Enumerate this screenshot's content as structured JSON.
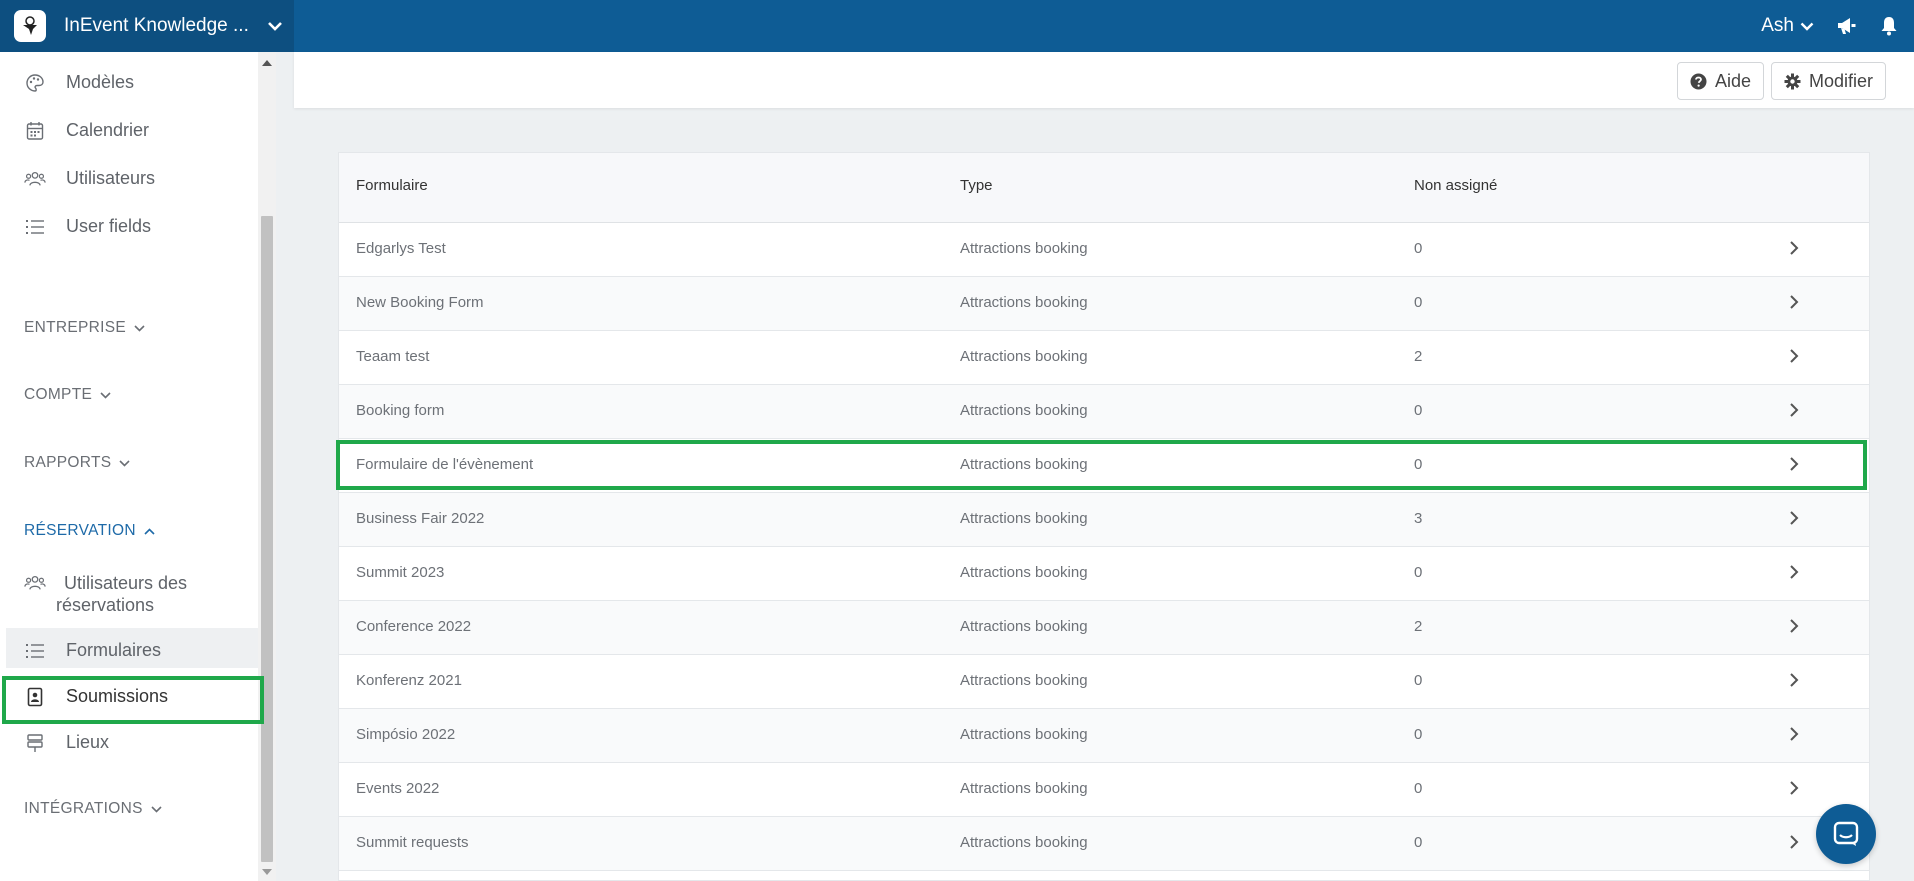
{
  "topbar": {
    "title": "InEvent Knowledge ...",
    "user": "Ash"
  },
  "sidebar": {
    "items": [
      {
        "label": "Modèles",
        "icon": "palette-icon"
      },
      {
        "label": "Calendrier",
        "icon": "calendar-icon"
      },
      {
        "label": "Utilisateurs",
        "icon": "users-icon"
      },
      {
        "label": "User fields",
        "icon": "list-icon"
      }
    ],
    "sections": [
      {
        "label": "ENTREPRISE"
      },
      {
        "label": "COMPTE"
      },
      {
        "label": "RAPPORTS"
      },
      {
        "label": "RÉSERVATION"
      },
      {
        "label": "INTÉGRATIONS"
      }
    ],
    "reservation_items": [
      {
        "label_line1": "Utilisateurs des",
        "label_line2": "réservations",
        "icon": "users-icon"
      },
      {
        "label": "Formulaires",
        "icon": "list-icon"
      },
      {
        "label": "Soumissions",
        "icon": "contact-card-icon"
      },
      {
        "label": "Lieux",
        "icon": "signpost-icon"
      }
    ]
  },
  "header": {
    "help_label": "Aide",
    "edit_label": "Modifier"
  },
  "table": {
    "columns": [
      "Formulaire",
      "Type",
      "Non assigné"
    ],
    "rows": [
      {
        "form": "Edgarlys Test",
        "type": "Attractions booking",
        "unassigned": "0"
      },
      {
        "form": "New Booking Form",
        "type": "Attractions booking",
        "unassigned": "0"
      },
      {
        "form": "Teaam test",
        "type": "Attractions booking",
        "unassigned": "2"
      },
      {
        "form": "Booking form",
        "type": "Attractions booking",
        "unassigned": "0"
      },
      {
        "form": "Formulaire de l'évènement",
        "type": "Attractions booking",
        "unassigned": "0"
      },
      {
        "form": "Business Fair 2022",
        "type": "Attractions booking",
        "unassigned": "3"
      },
      {
        "form": "Summit 2023",
        "type": "Attractions booking",
        "unassigned": "0"
      },
      {
        "form": "Conference 2022",
        "type": "Attractions booking",
        "unassigned": "2"
      },
      {
        "form": "Konferenz 2021",
        "type": "Attractions booking",
        "unassigned": "0"
      },
      {
        "form": "Simpósio 2022",
        "type": "Attractions booking",
        "unassigned": "0"
      },
      {
        "form": "Events 2022",
        "type": "Attractions booking",
        "unassigned": "0"
      },
      {
        "form": "Summit requests",
        "type": "Attractions booking",
        "unassigned": "0"
      }
    ]
  },
  "colors": {
    "topbar": "#0e5c95",
    "highlight": "#1fa84a",
    "active_section": "#1e6aa8"
  }
}
